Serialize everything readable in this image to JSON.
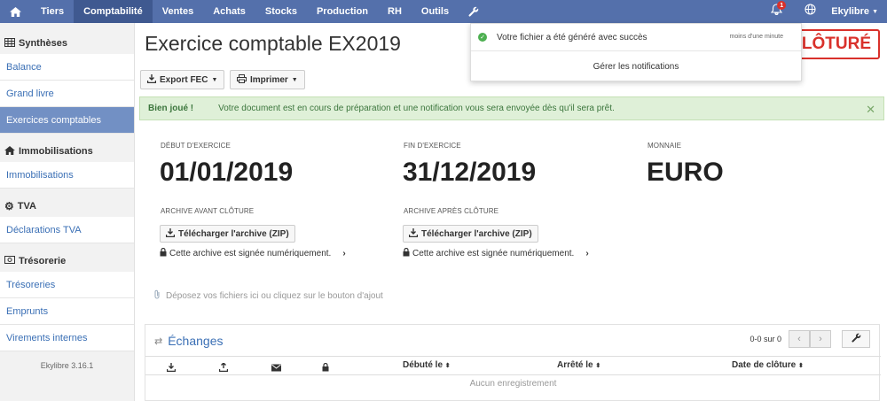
{
  "nav": {
    "home_icon": "home-icon",
    "items": [
      "Tiers",
      "Comptabilité",
      "Ventes",
      "Achats",
      "Stocks",
      "Production",
      "RH",
      "Outils"
    ],
    "active": "Comptabilité",
    "tools_icon": "wrench-icon",
    "notification_count": "1",
    "user": "Ekylibre"
  },
  "sidebar": {
    "sections": [
      {
        "title": "Synthèses",
        "icon": "table-icon",
        "items": [
          "Balance",
          "Grand livre",
          "Exercices comptables"
        ]
      },
      {
        "title": "Immobilisations",
        "icon": "home-icon",
        "items": [
          "Immobilisations"
        ]
      },
      {
        "title": "TVA",
        "icon": "gear-icon",
        "items": [
          "Déclarations TVA"
        ]
      },
      {
        "title": "Trésorerie",
        "icon": "money-icon",
        "items": [
          "Trésoreries",
          "Emprunts",
          "Virements internes"
        ]
      }
    ],
    "active_item": "Exercices comptables",
    "version": "Ekylibre 3.16.1"
  },
  "page": {
    "title": "Exercice comptable EX2019",
    "status": "CLÔTURÉ",
    "export_label": "Export FEC",
    "print_label": "Imprimer"
  },
  "alert": {
    "strong": "Bien joué !",
    "text": "Votre document est en cours de préparation et une notification vous sera envoyée dès qu'il sera prêt."
  },
  "fields": {
    "start_label": "Début d'exercice",
    "start_value": "01/01/2019",
    "end_label": "Fin d'exercice",
    "end_value": "31/12/2019",
    "currency_label": "Monnaie",
    "currency_value": "EURO",
    "archive_before_label": "Archive avant clôture",
    "archive_after_label": "Archive après clôture",
    "download_label": "Télécharger l'archive (ZIP)",
    "signed_text": "Cette archive est signée numériquement."
  },
  "dropzone": {
    "text": "Déposez vos fichiers ici ou cliquez sur le bouton d'ajout"
  },
  "exchanges": {
    "title": "Échanges",
    "pager": "0-0 sur 0",
    "columns": [
      "Débuté le",
      "Arrêté le",
      "Date de clôture"
    ],
    "empty": "Aucun enregistrement"
  },
  "notification": {
    "message": "Votre fichier a été généré avec succès",
    "time": "moins d'une minute",
    "manage": "Gérer les notifications"
  },
  "colors": {
    "nav_bg": "#5470ab",
    "nav_active": "#3f5990",
    "sidebar_active": "#7290c4",
    "status_red": "#d9312b",
    "alert_green": "#dff0d8"
  }
}
